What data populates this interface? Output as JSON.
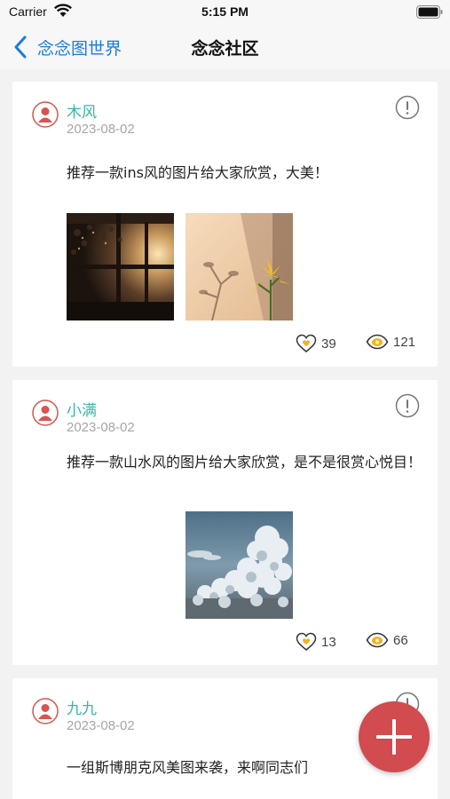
{
  "status_bar": {
    "carrier": "Carrier",
    "time": "5:15 PM"
  },
  "nav": {
    "back_label": "念念图世界",
    "title": "念念社区"
  },
  "posts": [
    {
      "author": "木风",
      "date": "2023-08-02",
      "text": "推荐一款ins风的图片给大家欣赏，大美！",
      "likes": "39",
      "views": "121",
      "images": [
        "window-sunset-photo",
        "lily-flower-photo"
      ]
    },
    {
      "author": "小满",
      "date": "2023-08-02",
      "text": "推荐一款山水风的图片给大家欣赏，是不是很赏心悦目！",
      "likes": "13",
      "views": "66",
      "images": [
        "cloudy-sky-photo"
      ]
    },
    {
      "author": "九九",
      "date": "2023-08-02",
      "text": "一组斯博朋克风美图来袭，来啊同志们"
    }
  ],
  "icons": {
    "back": "chevron-left-icon",
    "avatar": "user-avatar-icon",
    "report": "exclamation-circle-icon",
    "like": "heart-icon",
    "views": "eye-icon",
    "add": "plus-icon"
  },
  "colors": {
    "accent_blue": "#1a7be0",
    "author_teal": "#3ab5a6",
    "fab_red": "#d14b4f",
    "avatar_red": "#d9534f",
    "date_gray": "#a6a6a6"
  }
}
